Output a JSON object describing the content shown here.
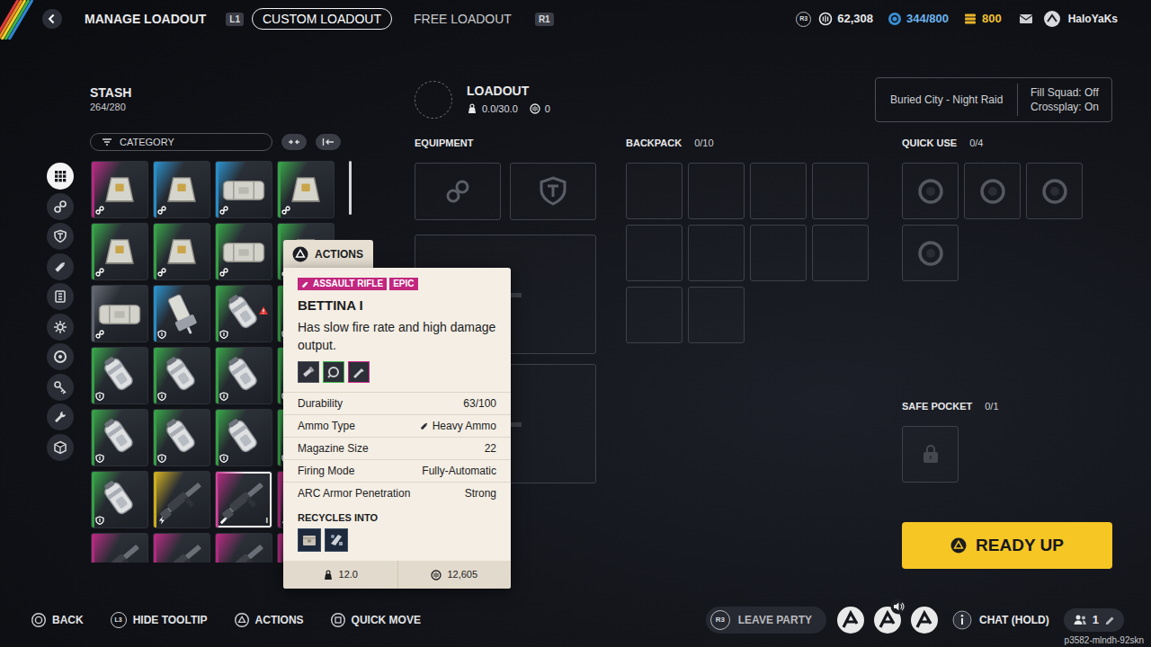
{
  "topbar": {
    "title": "MANAGE LOADOUT",
    "tab_key_left": "L1",
    "tabs": [
      {
        "label": "CUSTOM LOADOUT",
        "selected": true
      },
      {
        "label": "FREE LOADOUT",
        "selected": false
      }
    ],
    "tab_key_right": "R1",
    "currency_key": "R3",
    "currencies": [
      {
        "kind": "coins",
        "value": "62,308",
        "color": "#e8e8ea"
      },
      {
        "kind": "blue",
        "value": "344/800",
        "color": "#6cb4ef"
      },
      {
        "kind": "gold",
        "value": "800",
        "color": "#f2c232"
      }
    ],
    "username": "HaloYaKs"
  },
  "sidebar": {
    "items": [
      {
        "kind": "all",
        "selected": true
      },
      {
        "kind": "mods",
        "selected": false
      },
      {
        "kind": "shields",
        "selected": false
      },
      {
        "kind": "weapons",
        "selected": false
      },
      {
        "kind": "augments",
        "selected": false
      },
      {
        "kind": "materials",
        "selected": false
      },
      {
        "kind": "quick-use",
        "selected": false
      },
      {
        "kind": "keys",
        "selected": false
      },
      {
        "kind": "tools",
        "selected": false
      },
      {
        "kind": "misc",
        "selected": false
      }
    ]
  },
  "stash": {
    "title": "STASH",
    "count": "264/280",
    "filter": "CATEGORY",
    "items": [
      {
        "kind": "bag",
        "color": "#c92a8c",
        "badge": "mod",
        "warning": false,
        "selected": false
      },
      {
        "kind": "bag",
        "color": "#2a9ee0",
        "badge": "mod",
        "warning": false,
        "selected": false
      },
      {
        "kind": "case",
        "color": "#2a9ee0",
        "badge": "mod",
        "warning": false,
        "selected": false
      },
      {
        "kind": "bag",
        "color": "#39b54a",
        "badge": "mod",
        "warning": false,
        "selected": false
      },
      {
        "kind": "bag",
        "color": "#39b54a",
        "badge": "mod",
        "warning": false,
        "selected": false
      },
      {
        "kind": "bag",
        "color": "#39b54a",
        "badge": "mod",
        "warning": false,
        "selected": false
      },
      {
        "kind": "case",
        "color": "#39b54a",
        "badge": "mod",
        "warning": false,
        "selected": false
      },
      {
        "kind": "bag",
        "color": "#39b54a",
        "badge": "mod",
        "warning": false,
        "selected": false
      },
      {
        "kind": "case",
        "color": "#6c7079",
        "badge": "mod",
        "warning": false,
        "selected": false
      },
      {
        "kind": "device",
        "color": "#2a9ee0",
        "badge": "shield",
        "warning": false,
        "selected": false
      },
      {
        "kind": "canister",
        "color": "#39b54a",
        "badge": "shield",
        "warning": true,
        "selected": false
      },
      {
        "kind": "canister",
        "color": "#39b54a",
        "badge": "shield",
        "warning": false,
        "selected": false
      },
      {
        "kind": "canister",
        "color": "#39b54a",
        "badge": "shield",
        "warning": false,
        "selected": false
      },
      {
        "kind": "canister",
        "color": "#39b54a",
        "badge": "shield",
        "warning": false,
        "selected": false
      },
      {
        "kind": "canister",
        "color": "#39b54a",
        "badge": "shield",
        "warning": false,
        "selected": false
      },
      {
        "kind": "canister",
        "color": "#39b54a",
        "badge": "shield",
        "warning": false,
        "selected": false
      },
      {
        "kind": "canister",
        "color": "#39b54a",
        "badge": "shield",
        "warning": false,
        "selected": false
      },
      {
        "kind": "canister",
        "color": "#39b54a",
        "badge": "shield",
        "warning": false,
        "selected": false
      },
      {
        "kind": "canister",
        "color": "#39b54a",
        "badge": "shield",
        "warning": false,
        "selected": false
      },
      {
        "kind": "canister",
        "color": "#39b54a",
        "badge": "shield",
        "warning": false,
        "selected": false
      },
      {
        "kind": "canister",
        "color": "#39b54a",
        "badge": "shield",
        "warning": false,
        "selected": false
      },
      {
        "kind": "rifle",
        "color": "#e9c21c",
        "badge": "bolt",
        "warning": false,
        "selected": false
      },
      {
        "kind": "rifle",
        "color": "#c92a8c",
        "badge": "ammo",
        "warning": false,
        "selected": true,
        "tier": "I"
      },
      {
        "kind": "rifle",
        "color": "#c92a8c",
        "badge": "ammo",
        "warning": false,
        "selected": false
      },
      {
        "kind": "rifle",
        "color": "#c92a8c",
        "badge": "ammo",
        "warning": false,
        "selected": false
      },
      {
        "kind": "rifle",
        "color": "#c92a8c",
        "badge": "ammo",
        "warning": false,
        "selected": false
      },
      {
        "kind": "rifle",
        "color": "#c92a8c",
        "badge": "ammo",
        "warning": false,
        "selected": false
      },
      {
        "kind": "rifle",
        "color": "#c92a8c",
        "badge": "ammo",
        "warning": false,
        "selected": false
      }
    ]
  },
  "tooltip": {
    "actions_label": "ACTIONS",
    "category": "ASSAULT RIFLE",
    "rarity": "EPIC",
    "name": "BETTINA I",
    "description": "Has slow fire rate and high damage output.",
    "mods": [
      {
        "kind": "muzzle",
        "color": "#4a4f58"
      },
      {
        "kind": "grip",
        "color": "#39b54a"
      },
      {
        "kind": "stock",
        "color": "#c92a8c"
      }
    ],
    "stats": [
      {
        "label": "Durability",
        "value": "63/100",
        "kind": "plain"
      },
      {
        "label": "Ammo Type",
        "value": "Heavy Ammo",
        "kind": "ammo"
      },
      {
        "label": "Magazine Size",
        "value": "22",
        "kind": "plain"
      },
      {
        "label": "Firing Mode",
        "value": "Fully-Automatic",
        "kind": "plain"
      },
      {
        "label": "ARC Armor Penetration",
        "value": "Strong",
        "kind": "plain"
      }
    ],
    "recycles_label": "RECYCLES INTO",
    "recycles": [
      {
        "kind": "parts"
      },
      {
        "kind": "metal"
      }
    ],
    "weight": "12.0",
    "value": "12,605"
  },
  "loadout": {
    "title": "LOADOUT",
    "weight": "0.0/30.0",
    "value": "0",
    "map": "Buried City - Night Raid",
    "fill_squad": "Fill Squad: Off",
    "crossplay": "Crossplay: On",
    "equipment": {
      "label": "EQUIPMENT",
      "slots": [
        {
          "kind": "augment",
          "empty": true
        },
        {
          "kind": "shield",
          "empty": true
        },
        {
          "kind": "weapon",
          "empty": true
        },
        {
          "kind": "weapon",
          "empty": true
        }
      ]
    },
    "backpack": {
      "label": "BACKPACK",
      "count": "0/10",
      "slots": [
        {
          "empty": true
        },
        {
          "empty": true
        },
        {
          "empty": true
        },
        {
          "empty": true
        },
        {
          "empty": true
        },
        {
          "empty": true
        },
        {
          "empty": true
        },
        {
          "empty": true
        },
        {
          "empty": true
        },
        {
          "empty": true
        }
      ]
    },
    "quick_use": {
      "label": "QUICK USE",
      "count": "0/4",
      "slots": [
        {
          "empty": true
        },
        {
          "empty": true
        },
        {
          "empty": true
        },
        {
          "empty": true
        }
      ]
    },
    "safe_pocket": {
      "label": "SAFE POCKET",
      "count": "0/1",
      "slots": [
        {
          "empty": true
        }
      ]
    },
    "ready": "READY UP"
  },
  "hints": [
    {
      "kind": "circle",
      "label": "BACK"
    },
    {
      "kind": "stick",
      "key": "L3",
      "label": "HIDE TOOLTIP"
    },
    {
      "kind": "triangle",
      "label": "ACTIONS"
    },
    {
      "kind": "square",
      "label": "QUICK MOVE"
    }
  ],
  "party": {
    "leave_key": "R3",
    "leave_label": "LEAVE PARTY",
    "members": [
      {
        "speaking": false
      },
      {
        "speaking": true
      },
      {
        "speaking": false
      }
    ],
    "chat_label": "CHAT (HOLD)",
    "count": "1"
  },
  "session_id": "p3582-mlndh-92skn"
}
